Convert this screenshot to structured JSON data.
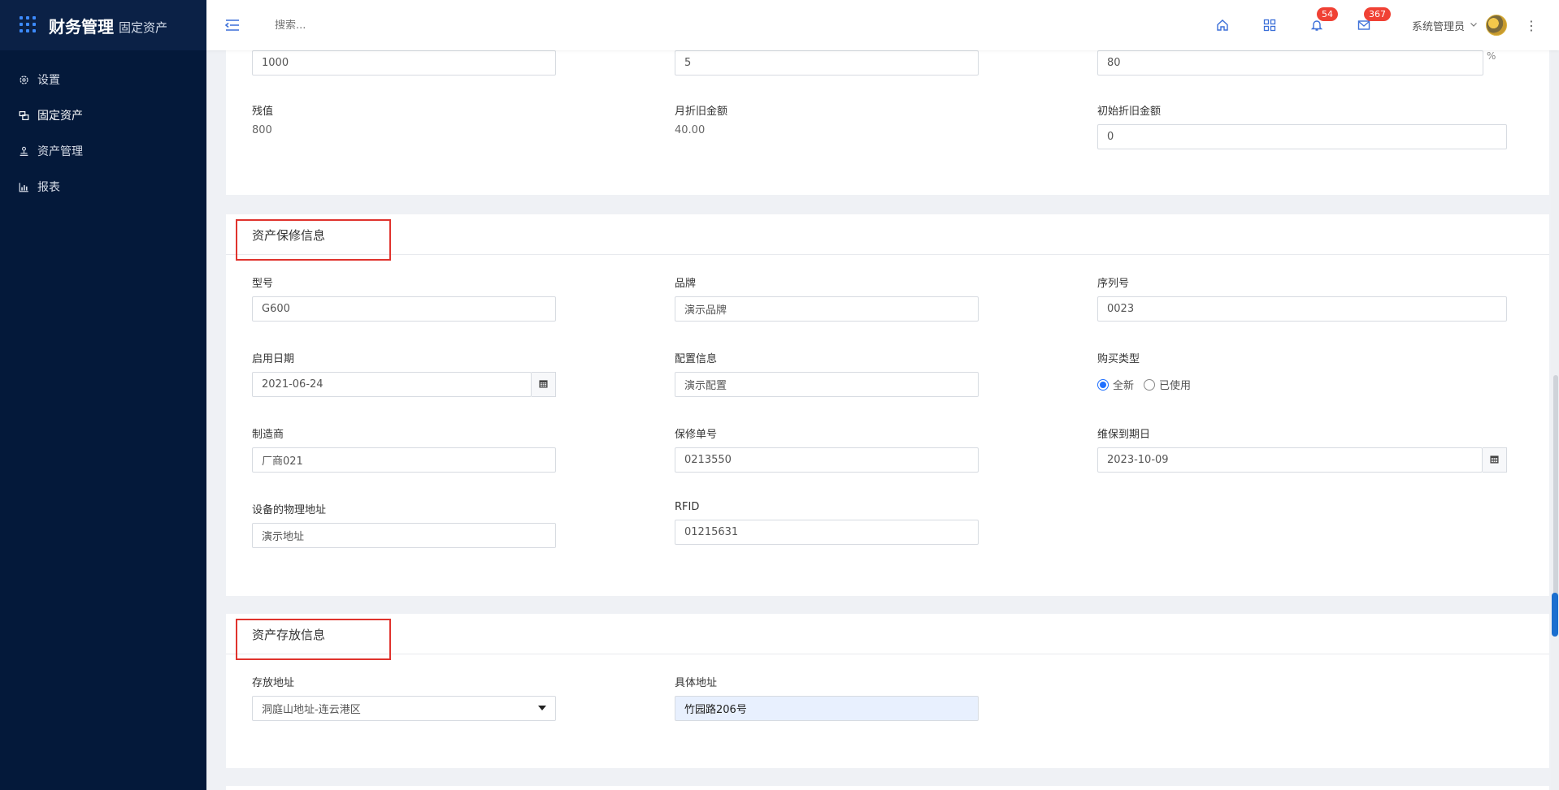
{
  "app": {
    "title": "财务管理",
    "subtitle": "固定资产"
  },
  "sidebar": {
    "items": [
      {
        "label": "设置",
        "icon": "gear-icon"
      },
      {
        "label": "固定资产",
        "icon": "assets-icon",
        "active": true
      },
      {
        "label": "资产管理",
        "icon": "manage-icon"
      },
      {
        "label": "报表",
        "icon": "chart-icon"
      }
    ]
  },
  "header": {
    "search_placeholder": "搜索...",
    "notifications_count": "54",
    "messages_count": "367",
    "user_name": "系统管理员"
  },
  "depreciation": {
    "original_value": "1000",
    "years": "5",
    "rate": "80",
    "percent_sign": "%",
    "residual_label": "残值",
    "residual_value": "800",
    "monthly_label": "月折旧金额",
    "monthly_value": "40.00",
    "initial_label": "初始折旧金额",
    "initial_value": "0"
  },
  "warranty": {
    "title": "资产保修信息",
    "model_label": "型号",
    "model_value": "G600",
    "brand_label": "品牌",
    "brand_value": "演示品牌",
    "serial_label": "序列号",
    "serial_value": "0023",
    "start_date_label": "启用日期",
    "start_date_value": "2021-06-24",
    "config_label": "配置信息",
    "config_value": "演示配置",
    "purchase_type_label": "购买类型",
    "purchase_options": [
      "全新",
      "已使用"
    ],
    "purchase_selected": "全新",
    "maker_label": "制造商",
    "maker_value": "厂商021",
    "warranty_no_label": "保修单号",
    "warranty_no_value": "0213550",
    "expiry_label": "维保到期日",
    "expiry_value": "2023-10-09",
    "address_label": "设备的物理地址",
    "address_value": "演示地址",
    "rfid_label": "RFID",
    "rfid_value": "01215631"
  },
  "storage": {
    "title": "资产存放信息",
    "location_label": "存放地址",
    "location_value": "洞庭山地址-连云港区",
    "detail_label": "具体地址",
    "detail_value": "竹园路206号"
  },
  "colors": {
    "sidebar_bg": "#04193a",
    "accent": "#1f6fff",
    "badge": "#f04134",
    "highlight_box": "#e0332d"
  }
}
